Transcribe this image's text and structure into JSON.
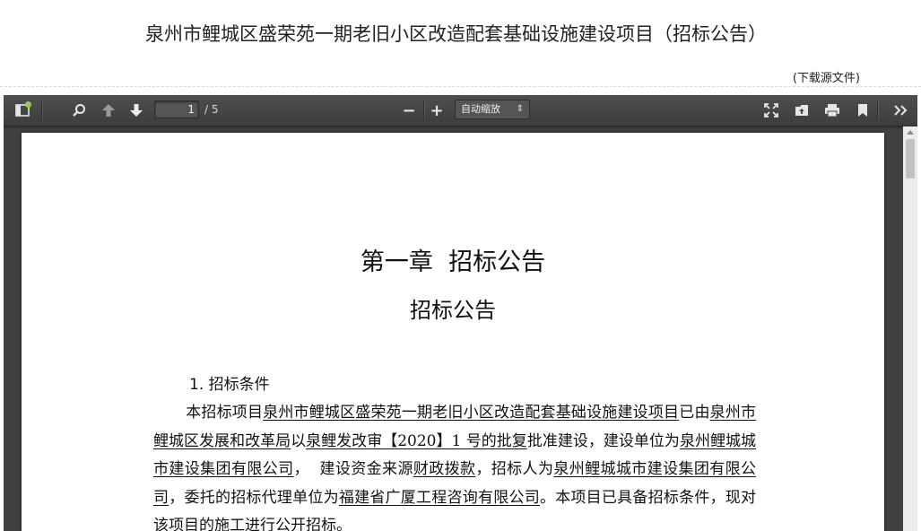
{
  "page": {
    "title": "泉州市鲤城区盛荣苑一期老旧小区改造配套基础设施建设项目（招标公告）",
    "download_link": "(下载源文件)"
  },
  "toolbar": {
    "current_page": "1",
    "page_count": "/ 5",
    "zoom_minus": "−",
    "zoom_plus": "+",
    "zoom_value": "自动缩放",
    "zoom_caret": "⇕"
  },
  "icons": {
    "sidebar_toggle": "sidebar-icon",
    "search": "search-icon",
    "prev_page": "arrow-up-icon",
    "next_page": "arrow-down-icon",
    "presentation": "fullscreen-icon",
    "open_file": "open-file-icon",
    "print": "print-icon",
    "bookmark": "bookmark-icon",
    "tools": "double-chevron-right-icon"
  },
  "colors": {
    "toolbar_bg": "#474747",
    "viewer_bg": "#404040",
    "sidebar_indicator": "#8fd14f"
  },
  "document": {
    "chapter_title": "第一章  招标公告",
    "notice_title": "招标公告",
    "section_heading": "1. 招标条件",
    "para": {
      "t1": "本招标项目",
      "project_name": "泉州市鲤城区盛荣苑一期老旧小区改造配套基础设施建设项目",
      "t2": "已由",
      "approval_authority": "泉州市鲤城区发展和改革局",
      "t3": "以",
      "approval_doc": "泉鲤发改审【2020】1 号的批复",
      "t4": "批准建设，建设单位为",
      "builder": "泉州鲤城城市建设集团有限公司",
      "t5": "，  建设资金来源",
      "fund_source": "财政拨款",
      "t6": "，招标人为",
      "tenderer": "泉州鲤城城市建设集团有限公司",
      "t7": "，委托的招标代理单位为",
      "agent": "福建省广厦工程咨询有限公司",
      "t8": "。本项目已具备招标条件，现对该项目的施工进行公开招标。"
    }
  }
}
